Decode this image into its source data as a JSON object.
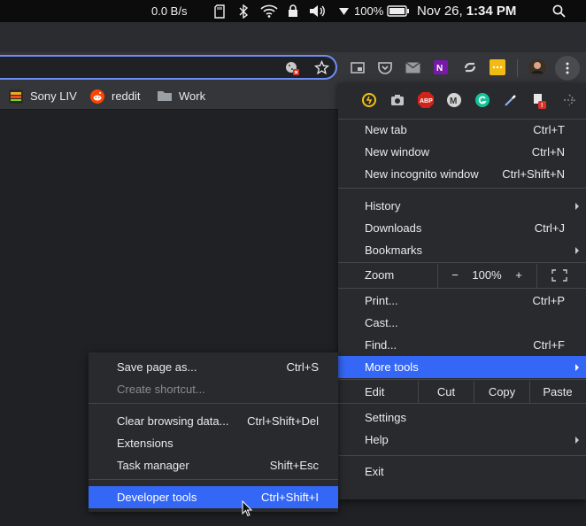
{
  "system_bar": {
    "network_speed": "0.0 B/s",
    "battery_percent": "100%",
    "date": "Nov 26,",
    "time": "1:34 PM"
  },
  "bookmarks": [
    {
      "label": "Sony LIV",
      "icon": "sonyliv-icon"
    },
    {
      "label": "reddit",
      "icon": "reddit-icon"
    },
    {
      "label": "Work",
      "icon": "folder-icon"
    }
  ],
  "main_menu": {
    "new_tab": {
      "label": "New tab",
      "shortcut": "Ctrl+T"
    },
    "new_window": {
      "label": "New window",
      "shortcut": "Ctrl+N"
    },
    "new_incognito": {
      "label": "New incognito window",
      "shortcut": "Ctrl+Shift+N"
    },
    "history": {
      "label": "History"
    },
    "downloads": {
      "label": "Downloads",
      "shortcut": "Ctrl+J"
    },
    "bookmarks": {
      "label": "Bookmarks"
    },
    "zoom": {
      "label": "Zoom",
      "minus": "−",
      "value": "100%",
      "plus": "+"
    },
    "print": {
      "label": "Print...",
      "shortcut": "Ctrl+P"
    },
    "cast": {
      "label": "Cast..."
    },
    "find": {
      "label": "Find...",
      "shortcut": "Ctrl+F"
    },
    "more_tools": {
      "label": "More tools"
    },
    "edit": {
      "label": "Edit",
      "cut": "Cut",
      "copy": "Copy",
      "paste": "Paste"
    },
    "settings": {
      "label": "Settings"
    },
    "help": {
      "label": "Help"
    },
    "exit": {
      "label": "Exit"
    }
  },
  "sub_menu": {
    "save_page": {
      "label": "Save page as...",
      "shortcut": "Ctrl+S"
    },
    "create_shortcut": {
      "label": "Create shortcut..."
    },
    "clear_data": {
      "label": "Clear browsing data...",
      "shortcut": "Ctrl+Shift+Del"
    },
    "extensions": {
      "label": "Extensions"
    },
    "task_manager": {
      "label": "Task manager",
      "shortcut": "Shift+Esc"
    },
    "dev_tools": {
      "label": "Developer tools",
      "shortcut": "Ctrl+Shift+I"
    }
  },
  "colors": {
    "highlight": "#3467f6",
    "menu_bg": "#292a2d",
    "omnibox_focus": "#6e8ef5"
  }
}
